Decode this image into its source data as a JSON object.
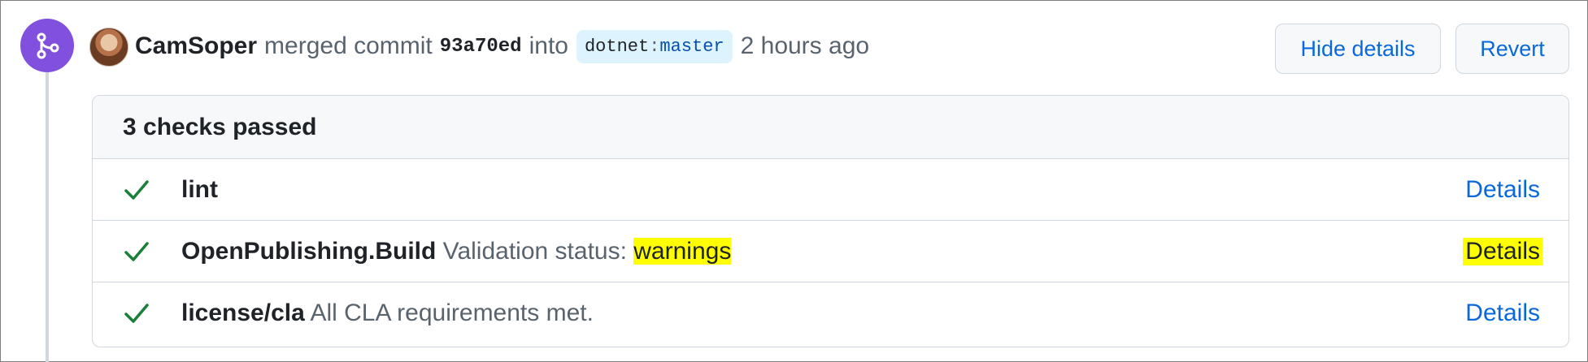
{
  "timeline": {
    "badge_icon": "git-merge-icon",
    "badge_color": "#8250df"
  },
  "event": {
    "author": "CamSoper",
    "action": "merged commit",
    "commit_sha": "93a70ed",
    "into_text": "into",
    "branch_repo": "dotnet",
    "branch_sep": ":",
    "branch_name": "master",
    "timestamp": "2 hours ago",
    "avatar_icon": "user-avatar"
  },
  "actions": {
    "hide_details_label": "Hide details",
    "revert_label": "Revert"
  },
  "checks": {
    "summary": "3 checks passed",
    "items": [
      {
        "name": "lint",
        "description": "",
        "description_highlight": "",
        "details_label": "Details",
        "status_icon": "check-icon",
        "details_highlighted": false
      },
      {
        "name": "OpenPublishing.Build",
        "description": "Validation status:",
        "description_highlight": "warnings",
        "details_label": "Details",
        "status_icon": "check-icon",
        "details_highlighted": true
      },
      {
        "name": "license/cla",
        "description": "All CLA requirements met.",
        "description_highlight": "",
        "details_label": "Details",
        "status_icon": "check-icon",
        "details_highlighted": false
      }
    ]
  },
  "colors": {
    "success": "#1a7f37",
    "link": "#0969da",
    "highlight": "#ffff00"
  }
}
